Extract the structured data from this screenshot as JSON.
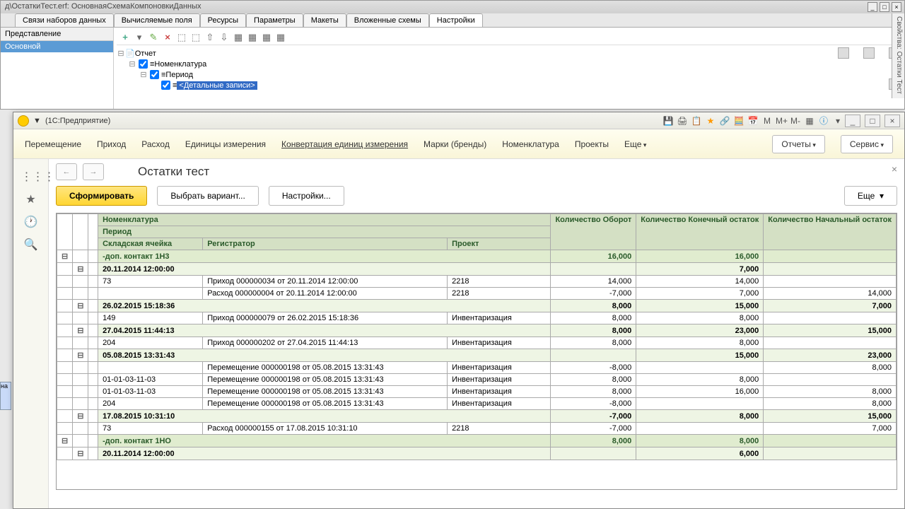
{
  "designer": {
    "title": "д\\ОстаткиТест.erf: ОсновнаяСхемаКомпоновкиДанных",
    "tabs": [
      "Связи наборов данных",
      "Вычисляемые поля",
      "Ресурсы",
      "Параметры",
      "Макеты",
      "Вложенные схемы",
      "Настройки"
    ],
    "left_head": "Представление",
    "left_row": "Основной",
    "tree": {
      "root": "Отчет",
      "n1": "Номенклатура",
      "n2": "Период",
      "n3": "<Детальные записи>"
    },
    "side": "Свойства: Остатки Тест"
  },
  "app": {
    "title": "(1С:Предприятие)",
    "ticons": {
      "m": "M",
      "mp": "M+",
      "mm": "M-"
    },
    "menu": [
      "Перемещение",
      "Приход",
      "Расход",
      "Единицы измерения",
      "Конвертация единиц измерения",
      "Марки (бренды)",
      "Номенклатура",
      "Проекты",
      "Еще"
    ],
    "reports_btn": "Отчеты",
    "service_btn": "Сервис",
    "page_title": "Остатки тест",
    "close": "×",
    "btn_form": "Сформировать",
    "btn_variant": "Выбрать вариант...",
    "btn_settings": "Настройки...",
    "btn_more": "Еще",
    "headers": {
      "c1": "Номенклатура",
      "c1b": "Период",
      "c1c": "Складская ячейка",
      "c2": "Регистратор",
      "c3": "Проект",
      "q1": "Количество Оборот",
      "q2": "Количество Конечный остаток",
      "q3": "Количество Начальный остаток"
    },
    "rows": [
      {
        "t": "g0",
        "c1": "-доп. контакт 1Н3",
        "q1": "16,000",
        "q2": "16,000",
        "q3": ""
      },
      {
        "t": "g1",
        "c1": "20.11.2014 12:00:00",
        "q1": "",
        "q2": "7,000",
        "q3": ""
      },
      {
        "t": "d",
        "c1": "73",
        "c2": "Приход 000000034 от 20.11.2014 12:00:00",
        "c3": "2218",
        "q1": "14,000",
        "q2": "14,000",
        "q3": ""
      },
      {
        "t": "d",
        "c1": "",
        "c2": "Расход 000000004 от 20.11.2014 12:00:00",
        "c3": "2218",
        "q1": "-7,000",
        "q2": "7,000",
        "q3": "14,000"
      },
      {
        "t": "g1",
        "c1": "26.02.2015 15:18:36",
        "q1": "8,000",
        "q2": "15,000",
        "q3": "7,000"
      },
      {
        "t": "d",
        "c1": "149",
        "c2": "Приход 000000079 от 26.02.2015 15:18:36",
        "c3": "Инвентаризация",
        "q1": "8,000",
        "q2": "8,000",
        "q3": ""
      },
      {
        "t": "g1",
        "c1": "27.04.2015 11:44:13",
        "q1": "8,000",
        "q2": "23,000",
        "q3": "15,000"
      },
      {
        "t": "d",
        "c1": "204",
        "c2": "Приход 000000202 от 27.04.2015 11:44:13",
        "c3": "Инвентаризация",
        "q1": "8,000",
        "q2": "8,000",
        "q3": ""
      },
      {
        "t": "g1",
        "c1": "05.08.2015 13:31:43",
        "q1": "",
        "q2": "15,000",
        "q3": "23,000"
      },
      {
        "t": "d",
        "c1": "",
        "c2": "Перемещение 000000198 от 05.08.2015 13:31:43",
        "c3": "Инвентаризация",
        "q1": "-8,000",
        "q2": "",
        "q3": "8,000"
      },
      {
        "t": "d",
        "c1": "01-01-03-11-03",
        "c2": "Перемещение 000000198 от 05.08.2015 13:31:43",
        "c3": "Инвентаризация",
        "q1": "8,000",
        "q2": "8,000",
        "q3": ""
      },
      {
        "t": "d",
        "c1": "01-01-03-11-03",
        "c2": "Перемещение 000000198 от 05.08.2015 13:31:43",
        "c3": "Инвентаризация",
        "q1": "8,000",
        "q2": "16,000",
        "q3": "8,000"
      },
      {
        "t": "d",
        "c1": "204",
        "c2": "Перемещение 000000198 от 05.08.2015 13:31:43",
        "c3": "Инвентаризация",
        "q1": "-8,000",
        "q2": "",
        "q3": "8,000"
      },
      {
        "t": "g1",
        "c1": "17.08.2015 10:31:10",
        "q1": "-7,000",
        "q2": "8,000",
        "q3": "15,000"
      },
      {
        "t": "d",
        "c1": "73",
        "c2": "Расход 000000155 от 17.08.2015 10:31:10",
        "c3": "2218",
        "q1": "-7,000",
        "q2": "",
        "q3": "7,000"
      },
      {
        "t": "g0",
        "c1": "-доп. контакт 1НО",
        "q1": "8,000",
        "q2": "8,000",
        "q3": ""
      },
      {
        "t": "g1",
        "c1": "20.11.2014 12:00:00",
        "q1": "",
        "q2": "6,000",
        "q3": ""
      }
    ]
  }
}
